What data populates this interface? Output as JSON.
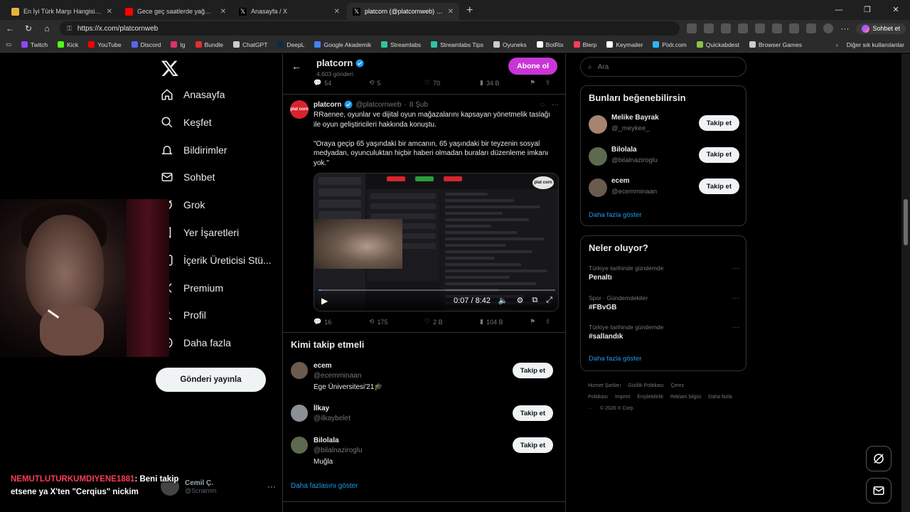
{
  "browser": {
    "tabs": [
      {
        "label": "En İyi Türk Marşı Hangisi? - Tier Li",
        "color": "#e7b43a",
        "active": false
      },
      {
        "label": "Gece geç saatlerde yağmurda otoy",
        "color": "#ff0000",
        "active": false
      },
      {
        "label": "Anasayfa / X",
        "color": "#ffffff",
        "active": false
      },
      {
        "label": "platcorn (@platcornweb) / X",
        "color": "#ffffff",
        "active": true
      }
    ],
    "url": "https://x.com/platcornweb",
    "sohbet_label": "Sohbet et",
    "bookmarks": [
      {
        "label": "Twitch",
        "color": "#9146ff"
      },
      {
        "label": "Kick",
        "color": "#53fc18"
      },
      {
        "label": "YouTube",
        "color": "#ff0000"
      },
      {
        "label": "Discord",
        "color": "#5865f2"
      },
      {
        "label": "Ig",
        "color": "#e1306c"
      },
      {
        "label": "Bundle",
        "color": "#e03030"
      },
      {
        "label": "ChatGPT",
        "color": "#cccccc"
      },
      {
        "label": "DeepL",
        "color": "#0f2b46"
      },
      {
        "label": "Google Akademik",
        "color": "#4285f4"
      },
      {
        "label": "Streamlabs",
        "color": "#31c3a2"
      },
      {
        "label": "Streamlabs Tips",
        "color": "#31c3a2"
      },
      {
        "label": "Oyuneks",
        "color": "#cccccc"
      },
      {
        "label": "BotRix",
        "color": "#ffffff"
      },
      {
        "label": "Blerp",
        "color": "#ff3b5c"
      },
      {
        "label": "Keymailer",
        "color": "#ffffff"
      },
      {
        "label": "Pixlr.com",
        "color": "#2fb4ff"
      },
      {
        "label": "Quickabdest",
        "color": "#8bc34a"
      },
      {
        "label": "Browser Games",
        "color": "#cccccc"
      }
    ],
    "other_bookmarks": "Diğer sık kullanılanlar"
  },
  "nav": {
    "items": [
      {
        "label": "Anasayfa",
        "icon": "home-icon"
      },
      {
        "label": "Keşfet",
        "icon": "search-icon"
      },
      {
        "label": "Bildirimler",
        "icon": "bell-icon"
      },
      {
        "label": "Sohbet",
        "icon": "mail-icon"
      },
      {
        "label": "Grok",
        "icon": "grok-icon"
      },
      {
        "label": "Yer İşaretleri",
        "icon": "bookmark-icon"
      },
      {
        "label": "İçerik Üreticisi Stü...",
        "icon": "studio-icon"
      },
      {
        "label": "Premium",
        "icon": "x-premium-icon"
      },
      {
        "label": "Profil",
        "icon": "profile-icon"
      },
      {
        "label": "Daha fazla",
        "icon": "more-icon"
      }
    ],
    "post_button": "Gönderi yayınla",
    "account_name": "Cemil Ç.",
    "account_handle": "@Scraimm"
  },
  "overlay": {
    "chat_nick": "NEMUTLUTURKUMDIYENE1881",
    "chat_text": ": Beni takip etsene ya X'ten \"Cerqius\" nickim"
  },
  "profile_header": {
    "name": "platcorn",
    "posts_count": "4.603 gönderi",
    "subscribe_label": "Abone ol"
  },
  "prev_tweet_actions": {
    "replies": "54",
    "reposts": "5",
    "likes": "70",
    "views": "34 B"
  },
  "tweet": {
    "author": "platcorn",
    "handle": "@platcornweb",
    "date": "8 Şub",
    "text": "RRaenee, oyunlar ve dijital oyun mağazalarını kapsayan yönetmelik taslağı ile oyun geliştiricileri hakkında konuştu.\n\n\"Oraya geçip 65 yaşındaki bir amcanın, 65 yaşındaki bir teyzenin sosyal medyadan, oyunculuktan hiçbir haberi olmadan buraları düzenleme imkanı yok.\"",
    "avatar_text": "plat corn",
    "video": {
      "time": "0:07 / 8:42",
      "progress": 0.013,
      "logo_text": "plat corn"
    },
    "actions": {
      "replies": "16",
      "reposts": "175",
      "likes": "2 B",
      "views": "104 B"
    }
  },
  "who_to_follow": {
    "title": "Kimi takip etmeli",
    "users": [
      {
        "name": "ecem",
        "handle": "@ecemminaan",
        "bio": "Ege Üniversitesi'21🎓",
        "button": "Takip et",
        "color": "#6b5a4e"
      },
      {
        "name": "İlkay",
        "handle": "@ilkaybelet",
        "bio": "",
        "button": "Takip et",
        "color": "#8b8f96"
      },
      {
        "name": "Bilolala",
        "handle": "@bilalnaziroglu",
        "bio": "Muğla",
        "button": "Takip et",
        "color": "#5d6a4f"
      }
    ],
    "show_more": "Daha fazlasını göster"
  },
  "right": {
    "search_placeholder": "Ara",
    "suggest_title": "Bunları beğenebilirsin",
    "suggestions": [
      {
        "name": "Melike Bayrak",
        "handle": "@_meykee_",
        "button": "Takip et",
        "color": "#a68471"
      },
      {
        "name": "Bilolala",
        "handle": "@bilalnaziroglu",
        "button": "Takip et",
        "color": "#5d6a4f"
      },
      {
        "name": "ecem",
        "handle": "@ecemminaan",
        "button": "Takip et",
        "color": "#6b5a4e"
      }
    ],
    "suggest_more": "Daha fazla göster",
    "trends_title": "Neler oluyor?",
    "trends": [
      {
        "context": "Türkiye tarihinde gündemde",
        "topic": "Penaltı"
      },
      {
        "context": "Spor · Gündemdekiler",
        "topic": "#FBvGB"
      },
      {
        "context": "Türkiye tarihinde gündemde",
        "topic": "#sallandık"
      }
    ],
    "trends_more": "Daha fazla göster",
    "footer": [
      "Hizmet Şartları",
      "Gizlilik Politikası",
      "Çerez Politikası",
      "Imprint",
      "Erişilebilirlik",
      "Reklam bilgisi",
      "Daha fazla ···",
      "© 2026 X Corp."
    ]
  },
  "colors": {
    "accent": "#1d9bf0",
    "subscribe": "#c936d7",
    "background": "#000000",
    "border": "#2f3336"
  }
}
